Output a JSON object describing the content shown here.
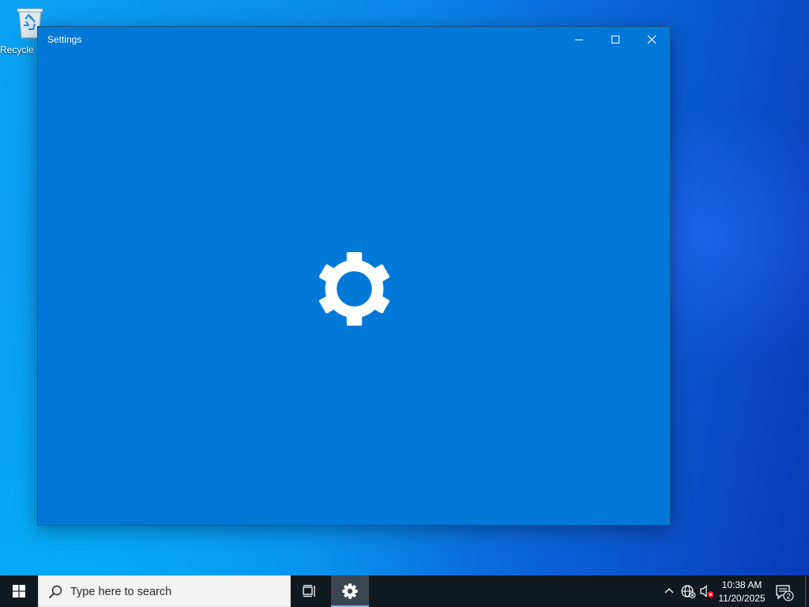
{
  "desktop": {
    "icons": [
      {
        "label": "Recycle Bin",
        "icon": "recycle-bin-icon"
      }
    ]
  },
  "window": {
    "title": "Settings",
    "controls": {
      "minimize": "minimize-icon",
      "maximize": "maximize-icon",
      "close": "close-icon"
    },
    "splash_icon": "gear-icon",
    "background": "#0078d7"
  },
  "taskbar": {
    "start_icon": "windows-logo-icon",
    "search": {
      "placeholder": "Type here to search",
      "icon": "search-icon"
    },
    "task_view_icon": "task-view-icon",
    "pinned": [
      {
        "name": "Settings",
        "icon": "gear-icon",
        "active": true
      }
    ],
    "tray": {
      "chevron_icon": "chevron-up-icon",
      "network_icon": "globe-icon",
      "volume_icon": "speaker-muted-icon",
      "time": "10:38 AM",
      "date": "11/20/2025",
      "notifications": {
        "icon": "action-center-icon",
        "count": "2"
      }
    },
    "background": "#101820"
  }
}
